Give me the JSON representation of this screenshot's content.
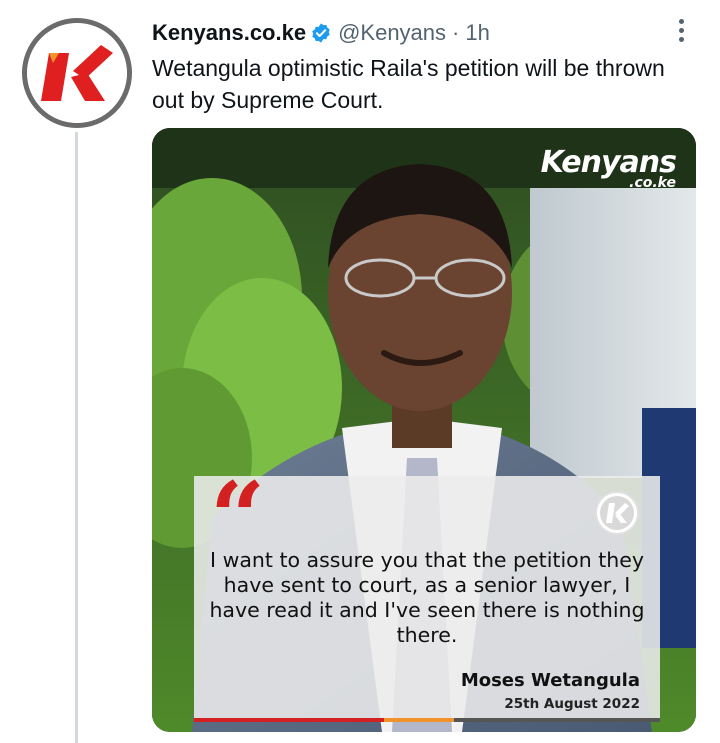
{
  "tweet": {
    "author": {
      "display_name": "Kenyans.co.ke",
      "handle": "@Kenyans",
      "verified": true,
      "avatar_icon": "kenyans-k-logo"
    },
    "separator": "·",
    "time": "1h",
    "text": "Wetangula optimistic Raila's petition will be thrown out by Supreme Court.",
    "more_icon": "more-dots-icon"
  },
  "media": {
    "watermark": {
      "main": "Kenyans",
      "sub": ".co.ke"
    },
    "quote": {
      "text": "I want to assure you that the petition they have sent to court, as a senior lawyer, I have read it and I've seen there is nothing there.",
      "author": "Moses Wetangula",
      "date": "25th August 2022"
    },
    "accent_colors": {
      "red": "#d32020",
      "orange": "#f0932b",
      "verified_blue": "#1d9bf0"
    }
  }
}
